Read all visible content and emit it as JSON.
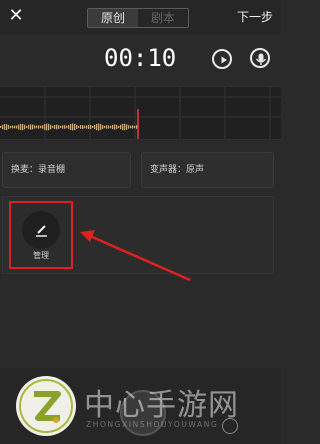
{
  "topbar": {
    "close_icon": "close-icon",
    "tabs": [
      {
        "label": "原创"
      },
      {
        "label": "剧本"
      }
    ],
    "next_label": "下一步"
  },
  "recorder": {
    "time": "00:10",
    "play_icon": "play-icon",
    "voice_icon": "mic-icon"
  },
  "options": {
    "accompaniment": "换麦：录音棚",
    "voice_changer": "变声器：原声"
  },
  "manage": {
    "label": "管理",
    "icon": "pencil-icon"
  },
  "watermark": {
    "title": "中心手游网",
    "subtitle": "ZHONGXINSHOUYOUWANG"
  },
  "colors": {
    "highlight": "#e02020",
    "waveform": "#c9a878",
    "playhead": "#e83b3b"
  }
}
